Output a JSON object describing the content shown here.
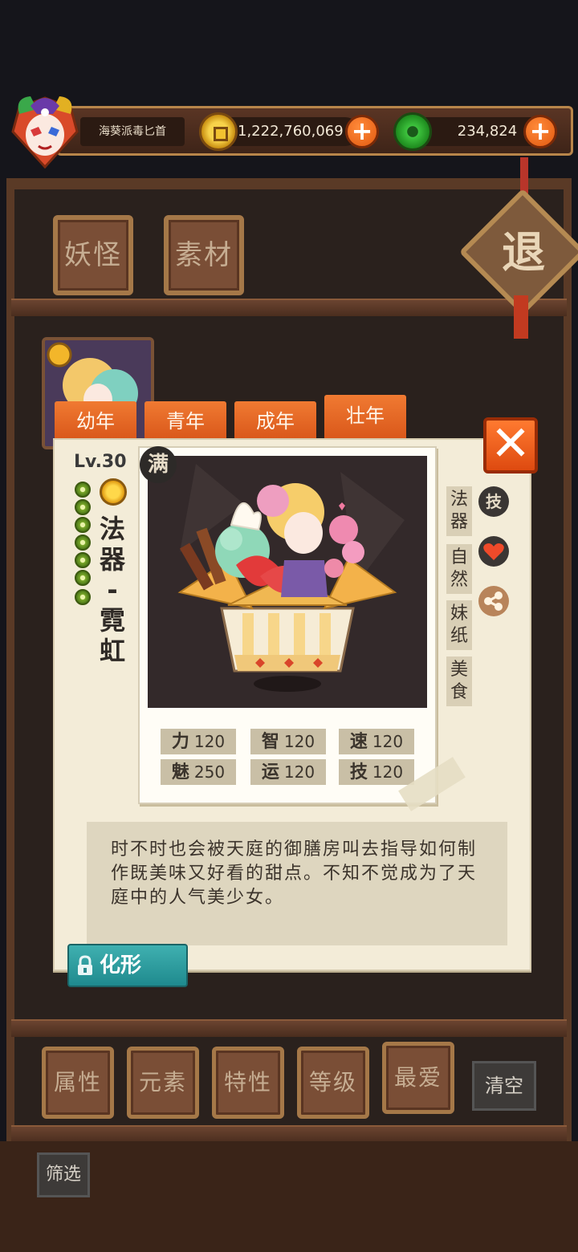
{
  "player": {
    "name": "海葵派毒匕首"
  },
  "resources": {
    "coins": "1,222,760,069",
    "jade": "234,824",
    "plus_symbol": "+"
  },
  "top_tabs": [
    "妖怪",
    "素材"
  ],
  "exit_label": "退",
  "age_tabs": [
    "幼年",
    "青年",
    "成年",
    "壮年"
  ],
  "active_age_tab": "壮年",
  "monster": {
    "level": "Lv.30",
    "name_chars": [
      "法",
      "器",
      "-",
      "霓",
      "虹"
    ],
    "max_badge": "满",
    "stats": [
      {
        "label": "力",
        "value": "120"
      },
      {
        "label": "智",
        "value": "120"
      },
      {
        "label": "速",
        "value": "120"
      },
      {
        "label": "魅",
        "value": "250"
      },
      {
        "label": "运",
        "value": "120"
      },
      {
        "label": "技",
        "value": "120"
      }
    ],
    "tags": [
      "法器",
      "自然",
      "妹纸",
      "美食"
    ],
    "skill_badge": "技",
    "description": "时不时也会被天庭的御膳房叫去指导如何制作既美味又好看的甜点。不知不觉成为了天庭中的人气美少女。"
  },
  "close_symbol": "✕",
  "transform_label": "化形",
  "filter_tabs": [
    "属性",
    "元素",
    "特性",
    "等级",
    "最爱"
  ],
  "clear_label": "清空",
  "screen_label": "筛选",
  "icons": [
    "coin-icon",
    "jade-icon",
    "plus-icon",
    "close-icon",
    "lock-icon",
    "heart-icon",
    "share-icon",
    "sun-icon"
  ],
  "colors": {
    "accent_orange": "#e8641e",
    "teal": "#2a9a9e",
    "card_bg": "#f3ecd8"
  }
}
